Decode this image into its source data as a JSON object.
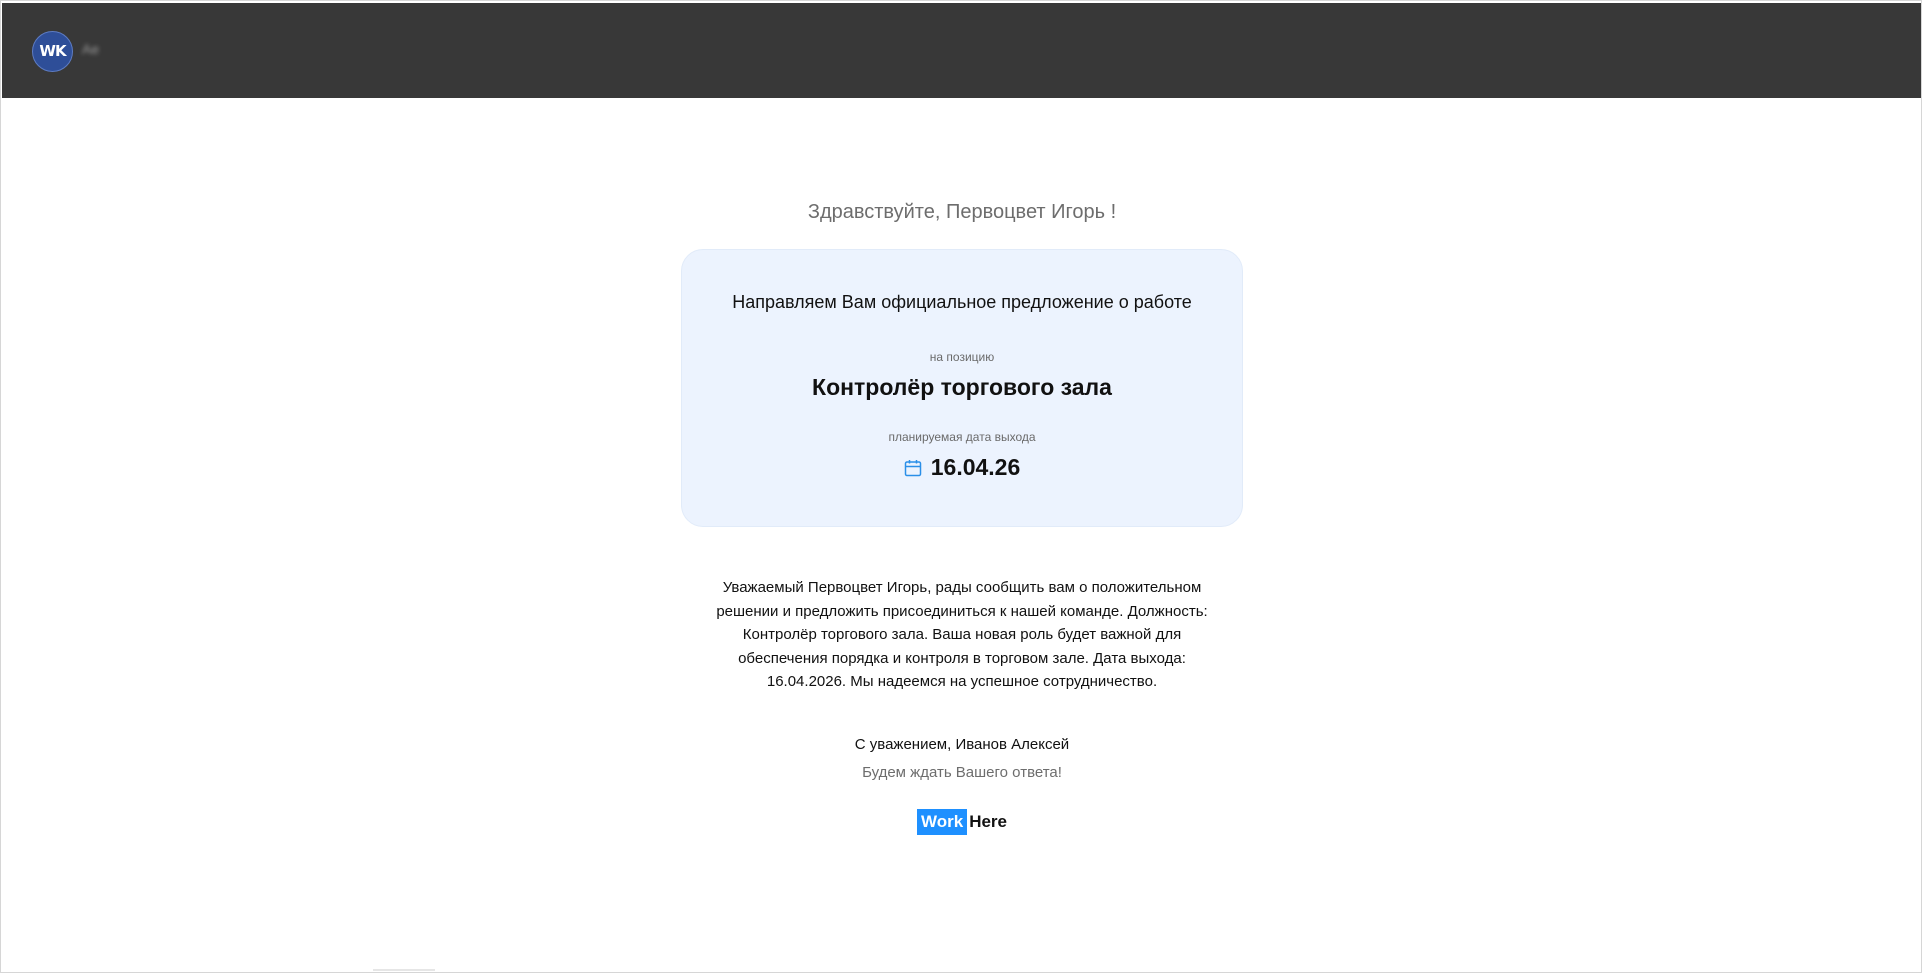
{
  "header": {
    "logo_text": "WK",
    "logo_name": "Ae"
  },
  "greeting": "Здравствуйте, Первоцвет Игорь !",
  "offer_card": {
    "intro": "Направляем Вам официальное предложение о работе",
    "position_label": "на позицию",
    "position": "Контролёр торгового зала",
    "date_label": "планируемая дата выхода",
    "date_icon": "calendar-icon",
    "date": "16.04.26"
  },
  "message": {
    "line1": "Уважаемый Первоцвет Игорь, рады сообщить вам о положительном",
    "line2": "решении и предложить присоединиться к нашей команде. Должность:",
    "line3": "Контролёр торгового зала. Ваша новая роль будет важной для",
    "line4": "обеспечения порядка и контроля в торговом зале. Дата выхода:",
    "line5": "16.04.2026. Мы надеемся на успешное сотрудничество."
  },
  "signature": "С уважением, Иванов Алексей",
  "awaiting_reply": "Будем ждать Вашего ответа!",
  "brand": {
    "part1": "Work",
    "part2": "Here"
  },
  "colors": {
    "topbar": "#383838",
    "card_background": "#ecf3fe",
    "brand_accent": "#1e90ff",
    "icon_accent": "#2a8fe8"
  }
}
